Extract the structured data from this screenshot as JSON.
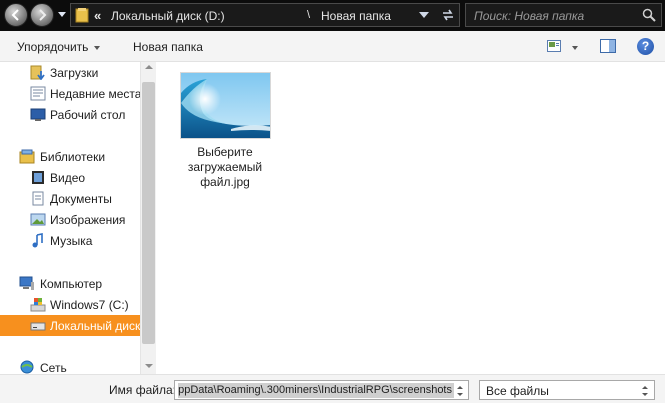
{
  "address_bar": {
    "overflow_chevron": "«",
    "crumbs": [
      "Локальный диск (D:)",
      "Новая папка"
    ],
    "separator": "\\",
    "search_placeholder": "Поиск: Новая папка"
  },
  "toolbar": {
    "organize_label": "Упорядочить",
    "new_folder_label": "Новая папка",
    "help_label": "?"
  },
  "sidebar": {
    "favorites": [
      {
        "label": "Загрузки",
        "icon": "downloads-icon"
      },
      {
        "label": "Недавние места",
        "icon": "recent-places-icon"
      },
      {
        "label": "Рабочий стол",
        "icon": "desktop-icon"
      }
    ],
    "libraries": {
      "label": "Библиотеки",
      "icon": "libraries-icon"
    },
    "library_items": [
      {
        "label": "Видео",
        "icon": "video-icon"
      },
      {
        "label": "Документы",
        "icon": "documents-icon"
      },
      {
        "label": "Изображения",
        "icon": "pictures-icon"
      },
      {
        "label": "Музыка",
        "icon": "music-icon"
      }
    ],
    "computer": {
      "label": "Компьютер",
      "icon": "computer-icon"
    },
    "drives": [
      {
        "label": "Windows7 (C:)",
        "icon": "system-drive-icon",
        "selected": false
      },
      {
        "label": "Локальный диск (D:)",
        "icon": "drive-icon",
        "selected": true
      }
    ],
    "network": {
      "label": "Сеть",
      "icon": "network-icon"
    }
  },
  "files": [
    {
      "name_line1": "Выберите",
      "name_line2": "загружаемый",
      "name_line3": "файл.jpg",
      "icon": "wave-image-thumbnail"
    }
  ],
  "bottom": {
    "filename_label": "Имя файла:",
    "filename_value": "ppData\\Roaming\\.300miners\\IndustrialRPG\\screenshots",
    "filetype_value": "Все файлы"
  },
  "colors": {
    "selection_accent": "#f7901e",
    "address_bar_bg": "#0c0c0c"
  }
}
